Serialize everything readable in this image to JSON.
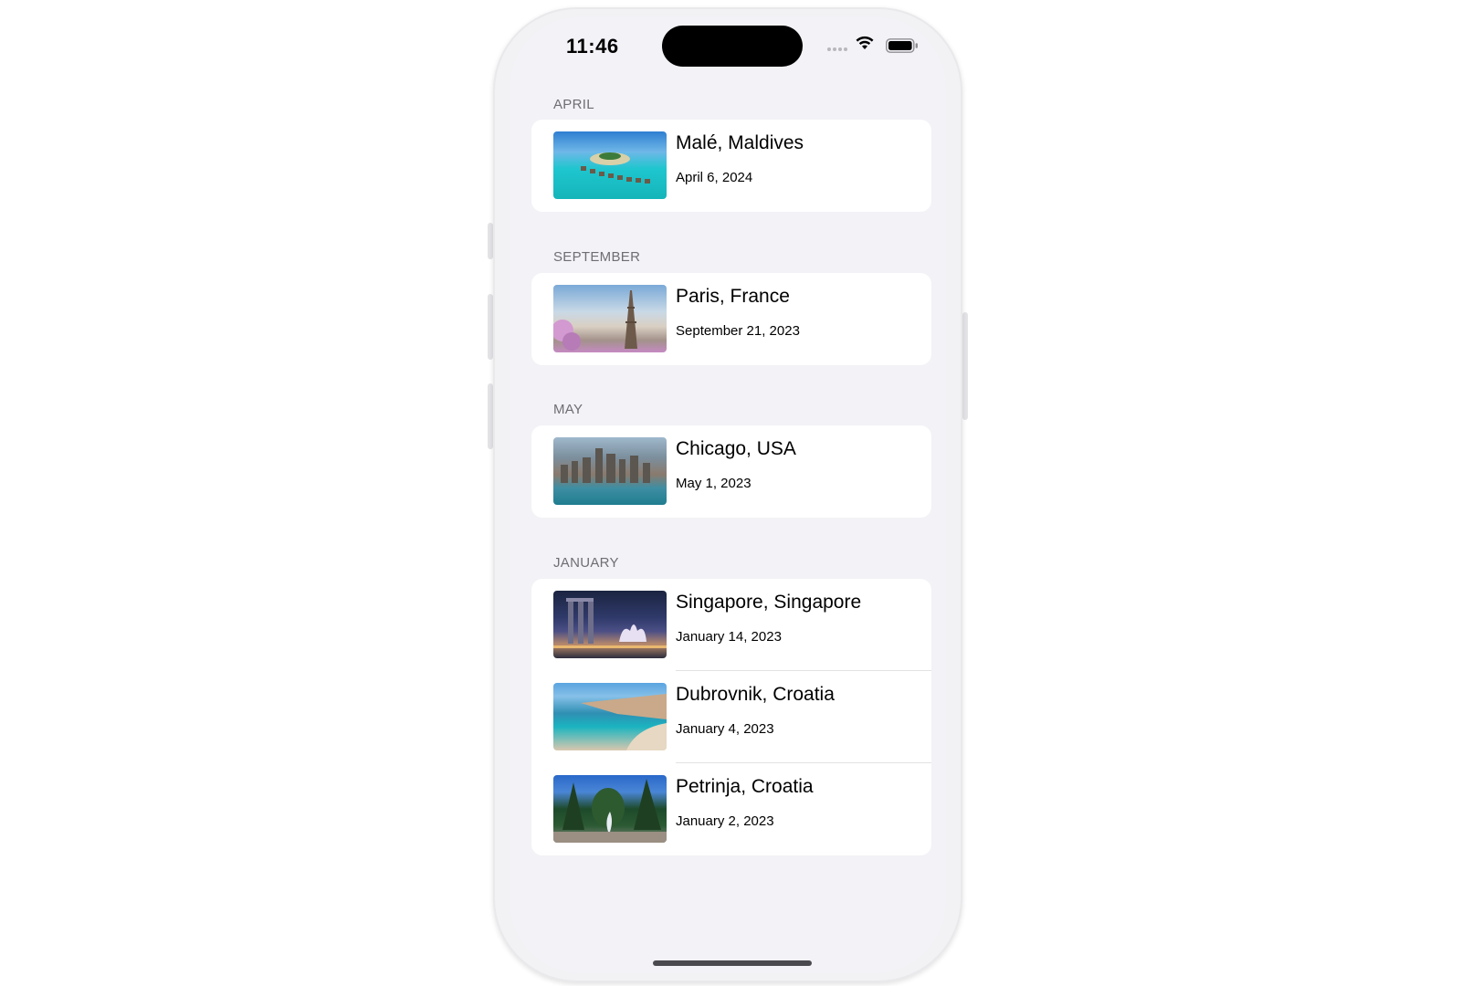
{
  "status_bar": {
    "time": "11:46"
  },
  "sections": [
    {
      "header": "APRIL",
      "trips": [
        {
          "title": "Malé, Maldives",
          "date": "April 6, 2024"
        }
      ]
    },
    {
      "header": "SEPTEMBER",
      "trips": [
        {
          "title": "Paris, France",
          "date": "September 21, 2023"
        }
      ]
    },
    {
      "header": "MAY",
      "trips": [
        {
          "title": "Chicago, USA",
          "date": "May 1, 2023"
        }
      ]
    },
    {
      "header": "JANUARY",
      "trips": [
        {
          "title": "Singapore, Singapore",
          "date": "January 14, 2023"
        },
        {
          "title": "Dubrovnik, Croatia",
          "date": "January 4, 2023"
        },
        {
          "title": "Petrinja, Croatia",
          "date": "January 2, 2023"
        }
      ]
    }
  ]
}
